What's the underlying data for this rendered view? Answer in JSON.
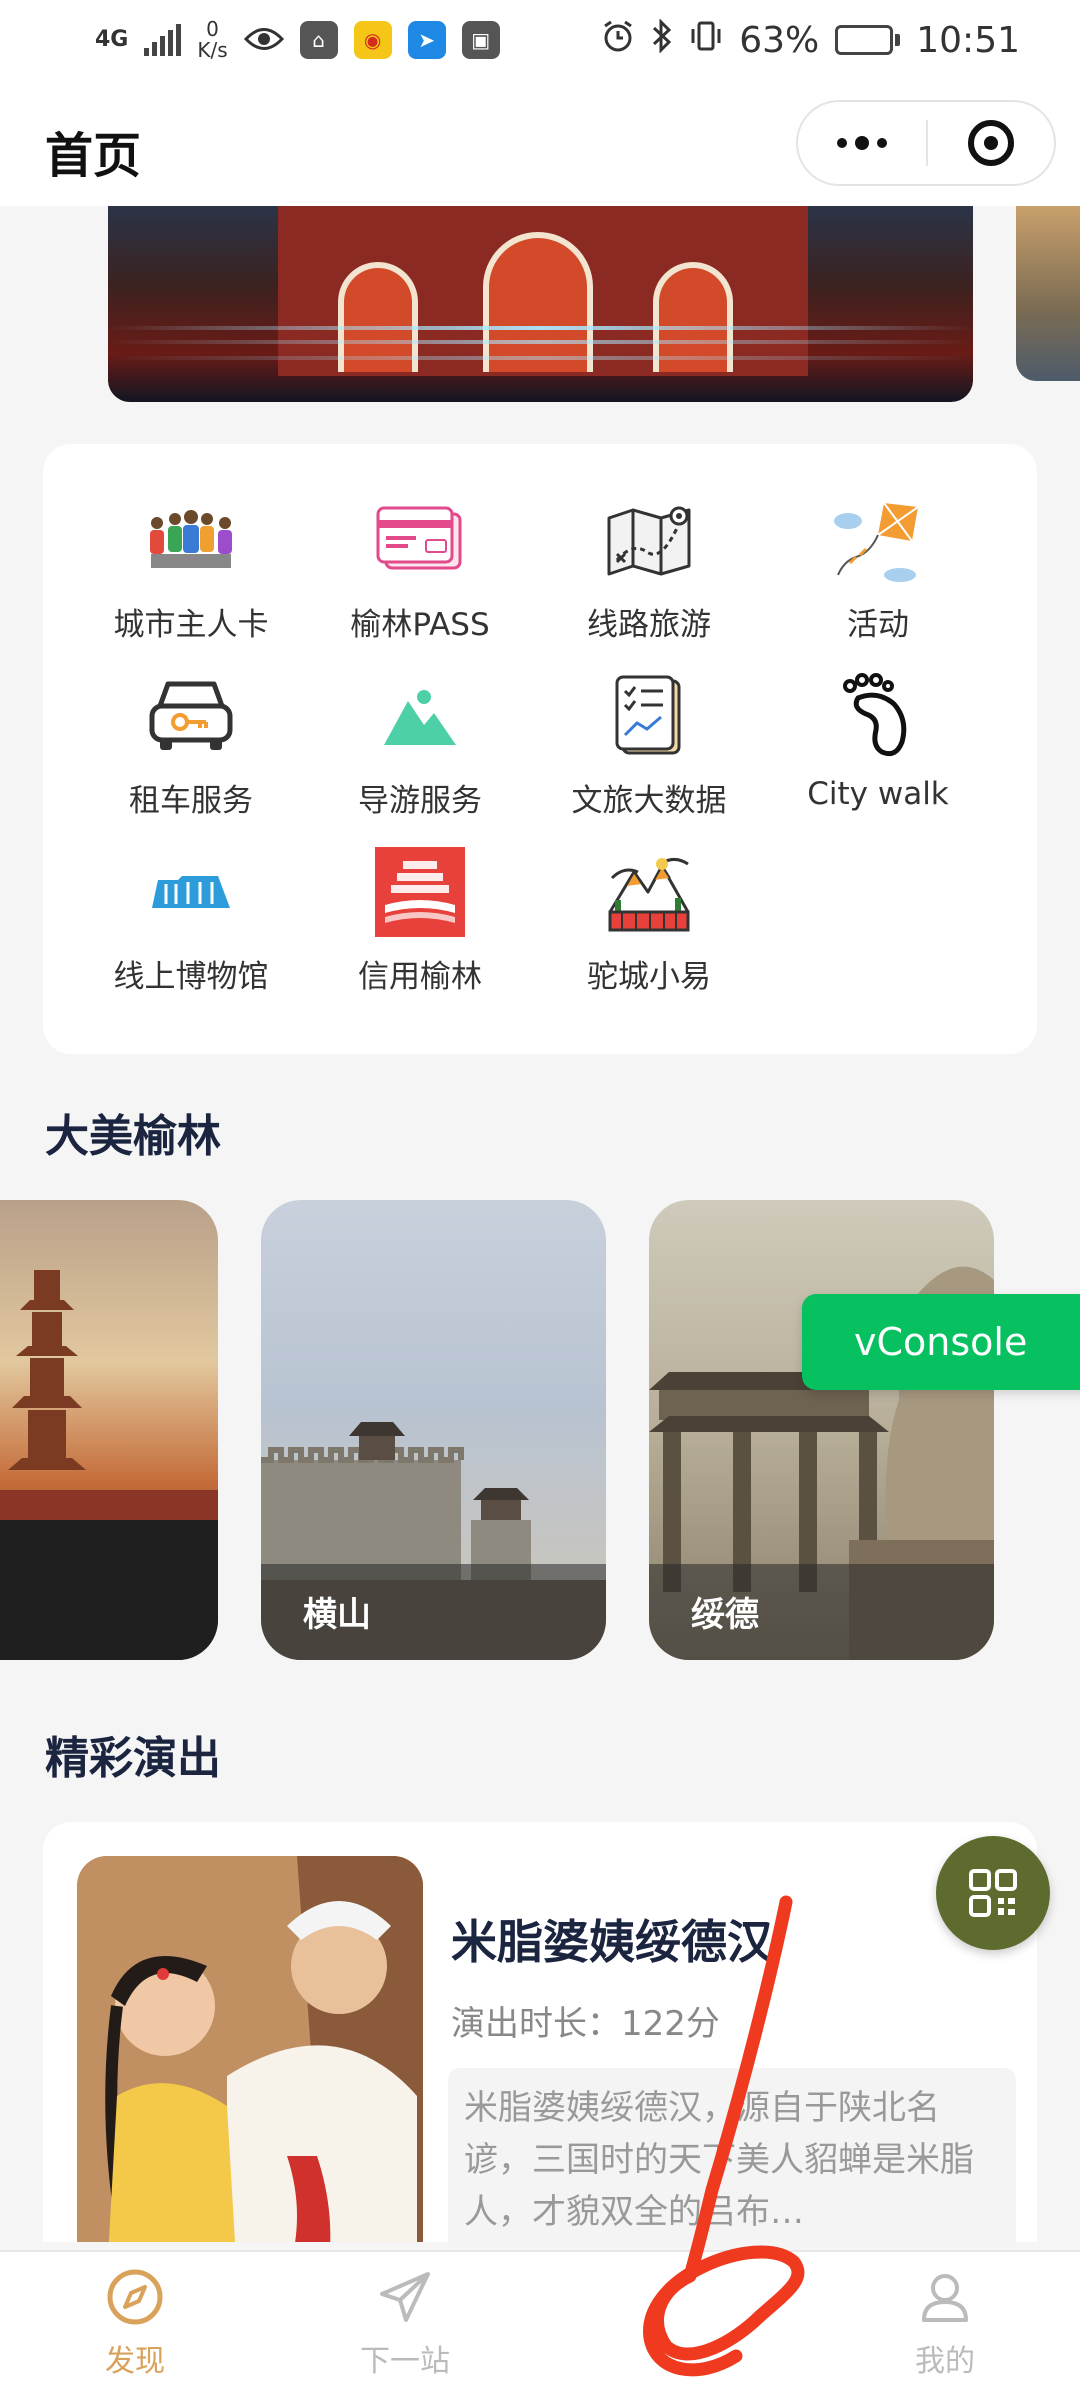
{
  "status_bar": {
    "network": "4G",
    "net_speed_value": "0",
    "net_speed_unit": "K/s",
    "battery": "63%",
    "time": "10:51",
    "battery_level": 0.63
  },
  "nav": {
    "title": "首页"
  },
  "services": [
    {
      "label": "城市主人卡",
      "icon": "people-group-icon"
    },
    {
      "label": "榆林PASS",
      "icon": "pass-card-icon"
    },
    {
      "label": "线路旅游",
      "icon": "route-map-icon"
    },
    {
      "label": "活动",
      "icon": "kite-icon"
    },
    {
      "label": "租车服务",
      "icon": "car-key-icon"
    },
    {
      "label": "导游服务",
      "icon": "mountain-icon"
    },
    {
      "label": "文旅大数据",
      "icon": "data-report-icon"
    },
    {
      "label": "City walk",
      "icon": "footprint-icon"
    },
    {
      "label": "线上博物馆",
      "icon": "museum-icon"
    },
    {
      "label": "信用榆林",
      "icon": "credit-icon"
    },
    {
      "label": "驼城小易",
      "icon": "landscape-icon"
    }
  ],
  "scenic": {
    "title": "大美榆林",
    "items": [
      {
        "name": ""
      },
      {
        "name": "横山"
      },
      {
        "name": "绥德"
      }
    ]
  },
  "vconsole": {
    "label": "vConsole"
  },
  "shows": {
    "title": "精彩演出",
    "items": [
      {
        "title": "米脂婆姨绥德汉",
        "duration": "演出时长：122分",
        "desc": "米脂婆姨绥德汉，源自于陕北名谚，三国时的天下美人貂蝉是米脂人，才貌双全的吕布…"
      }
    ]
  },
  "tabbar": {
    "items": [
      {
        "label": "发现",
        "icon": "compass-icon",
        "active": true
      },
      {
        "label": "下一站",
        "icon": "paper-plane-icon",
        "active": false
      },
      {
        "label": "",
        "icon": "center-icon",
        "active": false
      },
      {
        "label": "我的",
        "icon": "user-icon",
        "active": false
      }
    ]
  },
  "colors": {
    "accent_active": "#d9a25a",
    "vconsole_green": "#07c160",
    "qr_fab": "#5e6b2f",
    "title_navy": "#1b2540"
  }
}
